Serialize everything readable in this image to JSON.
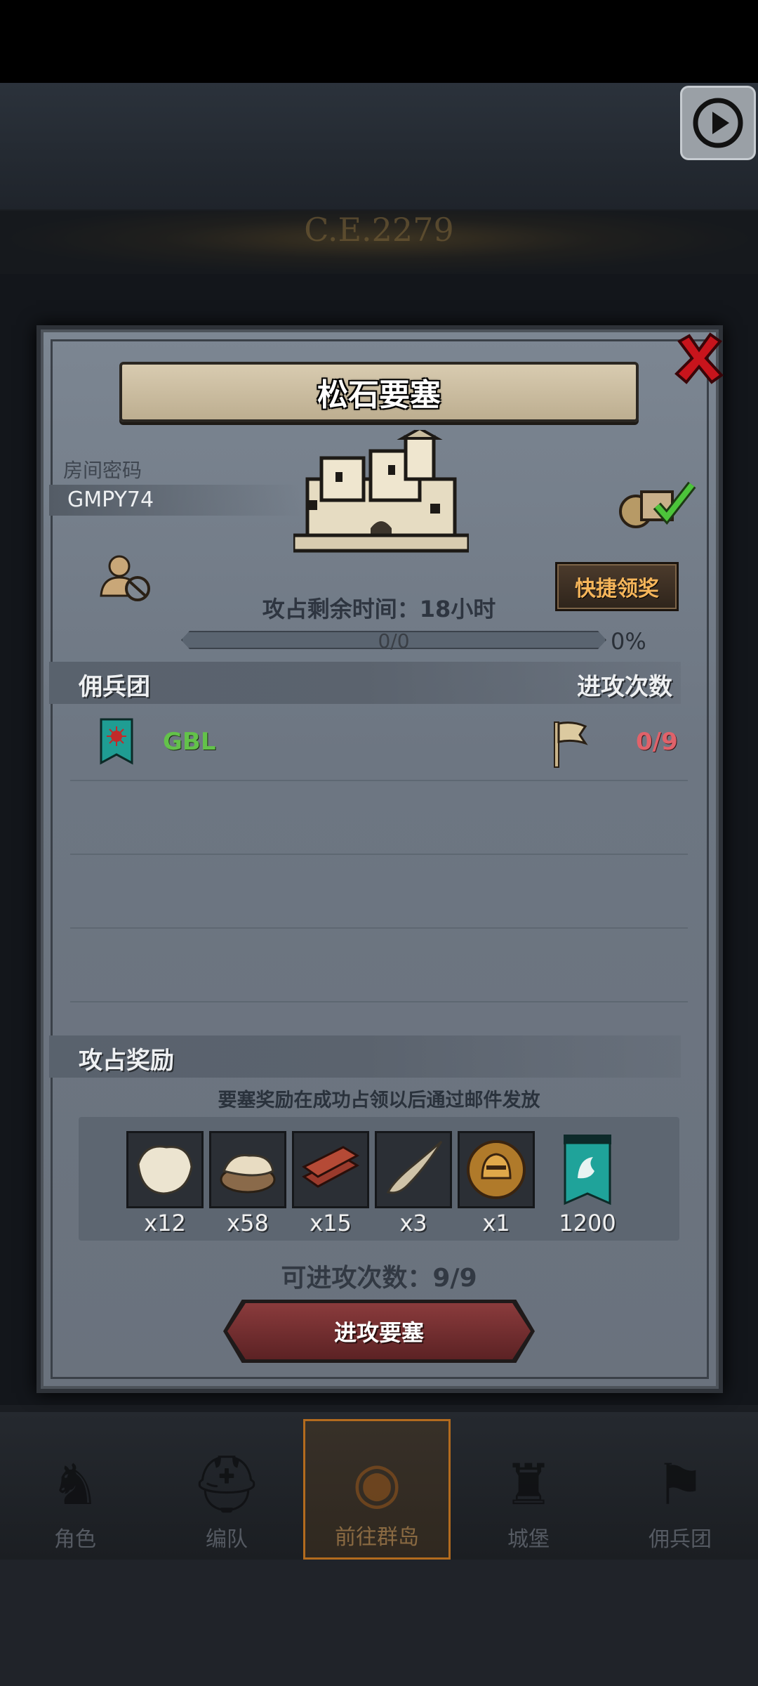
{
  "background": {
    "era_label": "C.E.2279"
  },
  "dialog": {
    "title": "松石要塞",
    "room_label": "房间密码",
    "room_code": "GMPY74",
    "quick_claim": "快捷领奖",
    "timer_text": "攻占剩余时间：18小时",
    "progress_text": "0/0",
    "progress_pct": "0%",
    "progress_fraction": 0,
    "mercenary_header": "佣兵团",
    "attack_count_header": "进攻次数",
    "guild": {
      "name": "GBL",
      "attacks": "0/9"
    },
    "reward_header": "攻占奖励",
    "reward_note": "要塞奖励在成功占领以后通过邮件发放",
    "rewards": [
      {
        "icon": "fur-pelt-icon",
        "qty": "x12"
      },
      {
        "icon": "hide-leather-icon",
        "qty": "x58"
      },
      {
        "icon": "wood-planks-icon",
        "qty": "x15"
      },
      {
        "icon": "horn-icon",
        "qty": "x3"
      },
      {
        "icon": "knight-coin-icon",
        "qty": "x1"
      },
      {
        "icon": "guild-banner-icon",
        "qty": "1200"
      }
    ],
    "attacks_left": "可进攻次数：9/9",
    "attack_button": "进攻要塞"
  },
  "nav": [
    {
      "label": "角色",
      "icon": "knight-icon"
    },
    {
      "label": "编队",
      "icon": "helmet-icon"
    },
    {
      "label": "前往群岛",
      "icon": "globe-icon"
    },
    {
      "label": "城堡",
      "icon": "castle-icon"
    },
    {
      "label": "佣兵团",
      "icon": "mercenary-icon"
    }
  ],
  "colors": {
    "guild_name": "#63c24a",
    "attack_count": "#e0626a",
    "quick_claim_text": "#f5b55a",
    "attack_button": "#8a3b3c"
  }
}
